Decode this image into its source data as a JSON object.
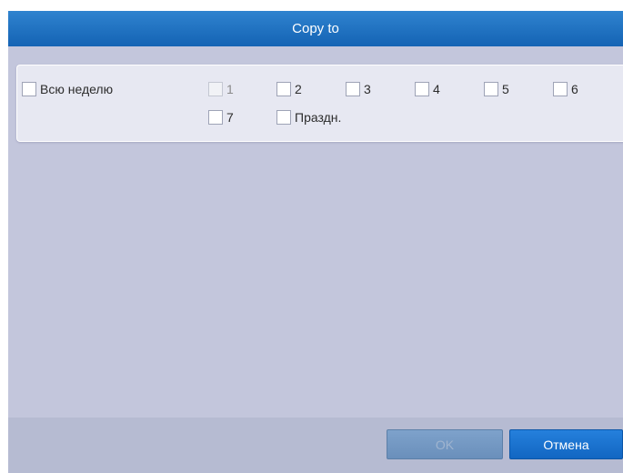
{
  "dialog": {
    "title": "Copy to"
  },
  "days": {
    "whole_week": "Всю неделю",
    "day1": "1",
    "day2": "2",
    "day3": "3",
    "day4": "4",
    "day5": "5",
    "day6": "6",
    "day7": "7",
    "holiday": "Праздн."
  },
  "buttons": {
    "ok_label": "OK",
    "cancel_label": "Отмена"
  }
}
